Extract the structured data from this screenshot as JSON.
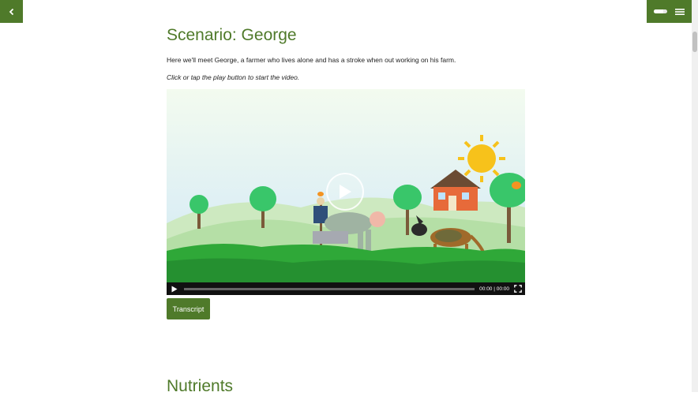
{
  "header": {
    "back_icon": "chevron-left-icon",
    "menu_icon": "hamburger-menu-icon",
    "progress": 0.7
  },
  "page": {
    "title": "Scenario: George",
    "intro": "Here we'll meet George, a farmer who lives alone and has a stroke when out working on his farm.",
    "hint": "Click or tap the play button to start the video."
  },
  "video": {
    "time_display": "00:00 | 00:00",
    "progress": 0
  },
  "buttons": {
    "transcript": "Transcript"
  },
  "next_section": {
    "title": "Nutrients"
  },
  "colors": {
    "accent": "#4f7a2a"
  }
}
